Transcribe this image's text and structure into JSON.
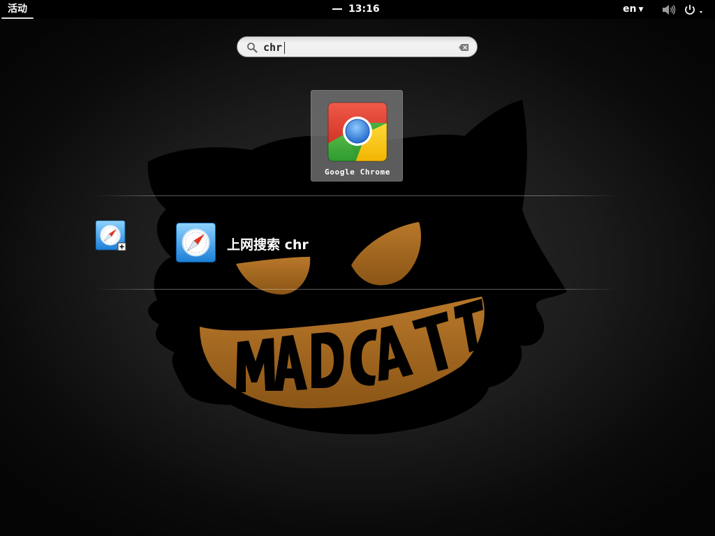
{
  "topbar": {
    "activities_label": "活动",
    "clock": "13:16",
    "keyboard_layout": "en"
  },
  "search": {
    "query": "chr"
  },
  "results": {
    "app": {
      "label": "Google Chrome",
      "icon": "chrome-icon"
    },
    "provider": {
      "icon": "safari-compass-icon"
    },
    "web_search": {
      "label": "上网搜索 chr",
      "icon": "safari-compass-icon"
    }
  },
  "wallpaper": {
    "text": "MADCAT",
    "colors": {
      "cat": "#000000",
      "accent": "#a46a1c"
    }
  },
  "colors": {
    "topbar": "#000000",
    "result_tile": "#808080",
    "search_bg": "#eeeeee"
  }
}
